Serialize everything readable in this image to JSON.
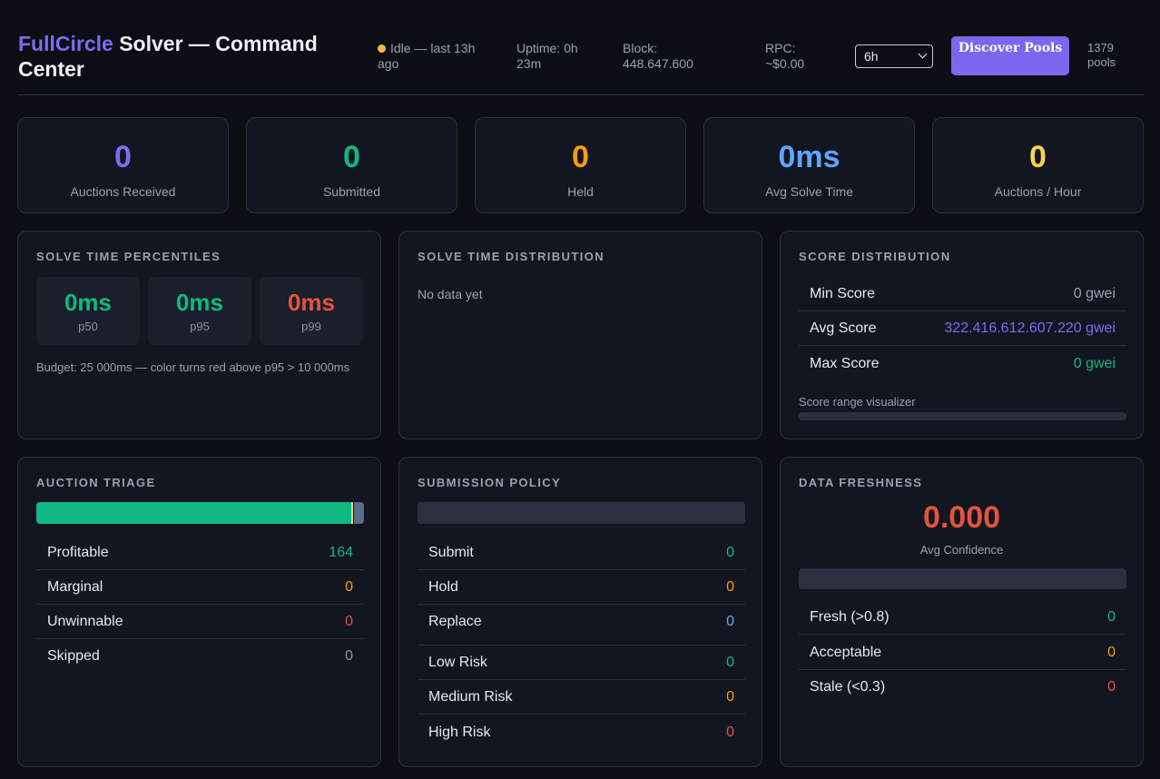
{
  "header": {
    "brand": "FullCircle",
    "title_rest": " Solver — Command Center",
    "status": "Idle — last 13h ago",
    "status_color": "#f5b942",
    "uptime": "Uptime: 0h 23m",
    "block": "Block: 448.647.600",
    "rpc": "RPC: ~$0.00",
    "range_value": "6h",
    "discover_label": "Discover Pools",
    "pools_count": "1379 pools"
  },
  "kpis": [
    {
      "value": "0",
      "label": "Auctions Received",
      "color": "#7c6cf0"
    },
    {
      "value": "0",
      "label": "Submitted",
      "color": "#10b981"
    },
    {
      "value": "0",
      "label": "Held",
      "color": "#f59e0b"
    },
    {
      "value": "0ms",
      "label": "Avg Solve Time",
      "color": "#60a5fa"
    },
    {
      "value": "0",
      "label": "Auctions / Hour",
      "color": "#fcd34d"
    }
  ],
  "percentiles": {
    "title": "SOLVE TIME PERCENTILES",
    "items": [
      {
        "value": "0ms",
        "label": "p50",
        "color": "#10b981"
      },
      {
        "value": "0ms",
        "label": "p95",
        "color": "#10b981"
      },
      {
        "value": "0ms",
        "label": "p99",
        "color": "#e5533c"
      }
    ],
    "budget_note": "Budget: 25 000ms — color turns red above p95 > 10 000ms"
  },
  "distribution": {
    "title": "SOLVE TIME DISTRIBUTION",
    "empty_text": "No data yet"
  },
  "score": {
    "title": "SCORE DISTRIBUTION",
    "rows": [
      {
        "label": "Min Score",
        "value": "0 gwei",
        "color": "#9aa1b0"
      },
      {
        "label": "Avg Score",
        "value": "322.416.612.607.220 gwei",
        "color": "#7c6cf0"
      },
      {
        "label": "Max Score",
        "value": "0 gwei",
        "color": "#10b981"
      }
    ],
    "visualizer_label": "Score range visualizer"
  },
  "triage": {
    "title": "AUCTION TRIAGE",
    "bar_segments": [
      {
        "name": "Profitable",
        "fraction": 0.96,
        "color": "#10b981"
      },
      {
        "name": "Marginal",
        "fraction": 0.006,
        "color": "#f5d37a"
      },
      {
        "name": "Unwinnable",
        "fraction": 0.004,
        "color": "#0b0e14"
      },
      {
        "name": "Skipped",
        "fraction": 0.03,
        "color": "#5b6b8c"
      }
    ],
    "rows": [
      {
        "label": "Profitable",
        "value": "164",
        "color": "#10b981"
      },
      {
        "label": "Marginal",
        "value": "0",
        "color": "#f59e0b"
      },
      {
        "label": "Unwinnable",
        "value": "0",
        "color": "#e5533c"
      },
      {
        "label": "Skipped",
        "value": "0",
        "color": "#8b92a1"
      }
    ]
  },
  "policy": {
    "title": "SUBMISSION POLICY",
    "rows": [
      {
        "label": "Submit",
        "value": "0",
        "color": "#10b981"
      },
      {
        "label": "Hold",
        "value": "0",
        "color": "#f59e0b"
      },
      {
        "label": "Replace",
        "value": "0",
        "color": "#60a5fa"
      }
    ],
    "risk_rows": [
      {
        "label": "Low Risk",
        "value": "0",
        "color": "#10b981"
      },
      {
        "label": "Medium Risk",
        "value": "0",
        "color": "#f59e0b"
      },
      {
        "label": "High Risk",
        "value": "0",
        "color": "#e5533c"
      }
    ]
  },
  "freshness": {
    "title": "DATA FRESHNESS",
    "confidence": "0.000",
    "confidence_color": "#e5533c",
    "confidence_label": "Avg Confidence",
    "rows": [
      {
        "label": "Fresh (>0.8)",
        "value": "0",
        "color": "#10b981"
      },
      {
        "label": "Acceptable",
        "value": "0",
        "color": "#f59e0b"
      },
      {
        "label": "Stale (<0.3)",
        "value": "0",
        "color": "#e5533c"
      }
    ]
  }
}
